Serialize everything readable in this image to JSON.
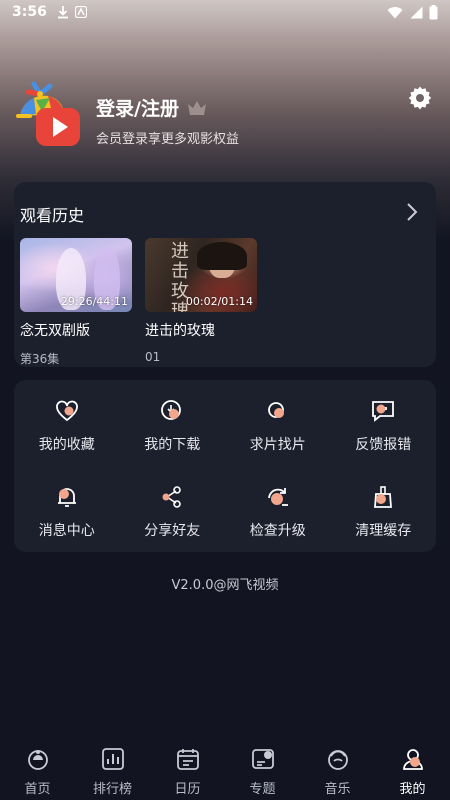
{
  "status_bar": {
    "time": "3:56"
  },
  "profile": {
    "title": "登录/注册",
    "subtitle": "会员登录享更多观影权益"
  },
  "history": {
    "header": "观看历史",
    "items": [
      {
        "title": "念无双剧版",
        "episode": "第36集",
        "time": "29:26/44:11"
      },
      {
        "title": "进击的玫瑰",
        "episode": "01",
        "time": "00:02/01:14",
        "poster_text": "进击玫瑰"
      }
    ]
  },
  "menu": {
    "items": [
      {
        "label": "我的收藏",
        "icon": "heart-icon"
      },
      {
        "label": "我的下载",
        "icon": "download-icon"
      },
      {
        "label": "求片找片",
        "icon": "search-movie-icon"
      },
      {
        "label": "反馈报错",
        "icon": "feedback-icon"
      },
      {
        "label": "消息中心",
        "icon": "bell-icon"
      },
      {
        "label": "分享好友",
        "icon": "share-icon"
      },
      {
        "label": "检查升级",
        "icon": "upgrade-icon"
      },
      {
        "label": "清理缓存",
        "icon": "broom-icon"
      }
    ]
  },
  "version": "V2.0.0@网飞视频",
  "tabbar": {
    "items": [
      {
        "label": "首页",
        "icon": "home-icon"
      },
      {
        "label": "排行榜",
        "icon": "ranking-icon"
      },
      {
        "label": "日历",
        "icon": "calendar-icon"
      },
      {
        "label": "专题",
        "icon": "topic-icon"
      },
      {
        "label": "音乐",
        "icon": "music-icon"
      },
      {
        "label": "我的",
        "icon": "profile-icon"
      }
    ],
    "active": "我的"
  },
  "colors": {
    "accent": "#f2a68c",
    "background": "#121521",
    "card": "#1c1f2c"
  }
}
